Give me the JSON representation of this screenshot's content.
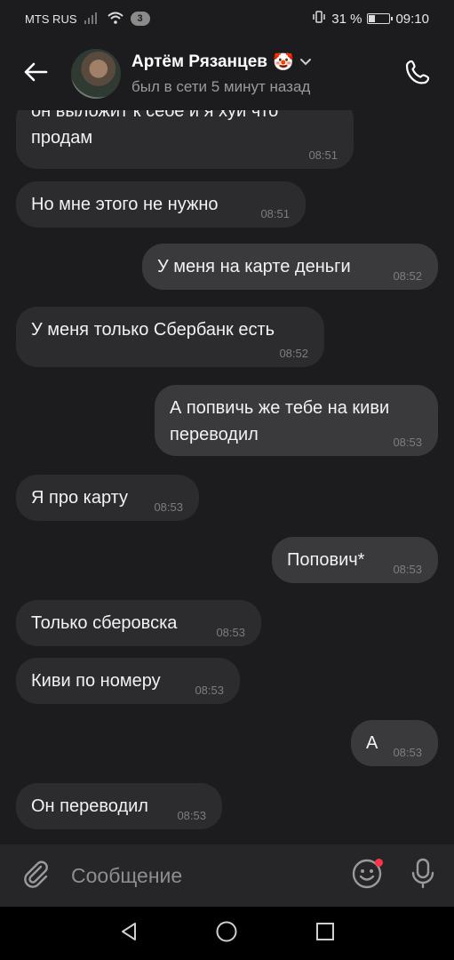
{
  "status_bar": {
    "carrier": "MTS RUS",
    "notification_count": "3",
    "battery_percent": "31 %",
    "battery_level": 0.31,
    "time": "09:10"
  },
  "header": {
    "contact_name": "Артём Рязанцев",
    "contact_emoji": "🤡",
    "last_seen": "был в сети 5 минут назад"
  },
  "messages": [
    {
      "direction": "in",
      "text_lines": [
        "он выложит к себе и я хуй что",
        "продам"
      ],
      "time": "08:51"
    },
    {
      "direction": "in",
      "text_lines": [
        "Но мне этого не нужно"
      ],
      "time": "08:51"
    },
    {
      "direction": "out",
      "text_lines": [
        "У меня на карте деньги"
      ],
      "time": "08:52"
    },
    {
      "direction": "in",
      "text_lines": [
        "У меня только Сбербанк есть"
      ],
      "time": "08:52"
    },
    {
      "direction": "out",
      "text_lines": [
        "А попвичь же тебе на киви",
        "переводил"
      ],
      "time": "08:53"
    },
    {
      "direction": "in",
      "text_lines": [
        "Я про карту"
      ],
      "time": "08:53"
    },
    {
      "direction": "out",
      "text_lines": [
        "Попович*"
      ],
      "time": "08:53"
    },
    {
      "direction": "in",
      "text_lines": [
        "Только сберовска"
      ],
      "time": "08:53"
    },
    {
      "direction": "in",
      "text_lines": [
        "Киви по номеру"
      ],
      "time": "08:53"
    },
    {
      "direction": "out",
      "text_lines": [
        "А"
      ],
      "time": "08:53"
    },
    {
      "direction": "in",
      "text_lines": [
        "Он переводил"
      ],
      "time": "08:53"
    }
  ],
  "composer": {
    "placeholder": "Сообщение"
  },
  "icons": {
    "back": "arrow-left-icon",
    "call": "phone-icon",
    "attach": "paperclip-icon",
    "emoji": "smiley-icon",
    "mic": "microphone-icon",
    "nav_back": "triangle-back-icon",
    "nav_home": "circle-home-icon",
    "nav_recent": "square-recents-icon"
  },
  "colors": {
    "background": "#1c1c1e",
    "bubble_in": "#2c2c2e",
    "bubble_out": "#3a3a3c",
    "notification_dot": "#ff3347"
  }
}
